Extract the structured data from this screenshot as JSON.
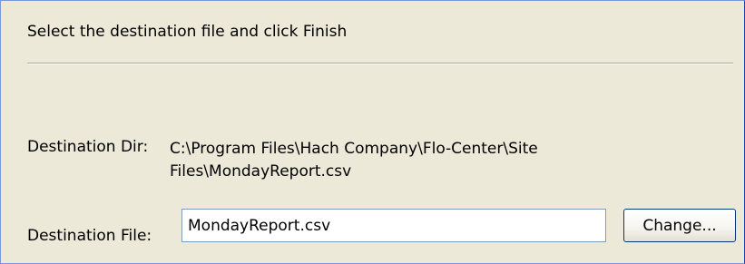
{
  "header": {
    "instruction": "Select the destination file and click Finish"
  },
  "destination_dir": {
    "label": "Destination Dir:",
    "value": "C:\\Program Files\\Hach Company\\Flo-Center\\Site Files\\MondayReport.csv"
  },
  "destination_file": {
    "label": "Destination File:",
    "value": "MondayReport.csv"
  },
  "buttons": {
    "change_label": "Change..."
  }
}
